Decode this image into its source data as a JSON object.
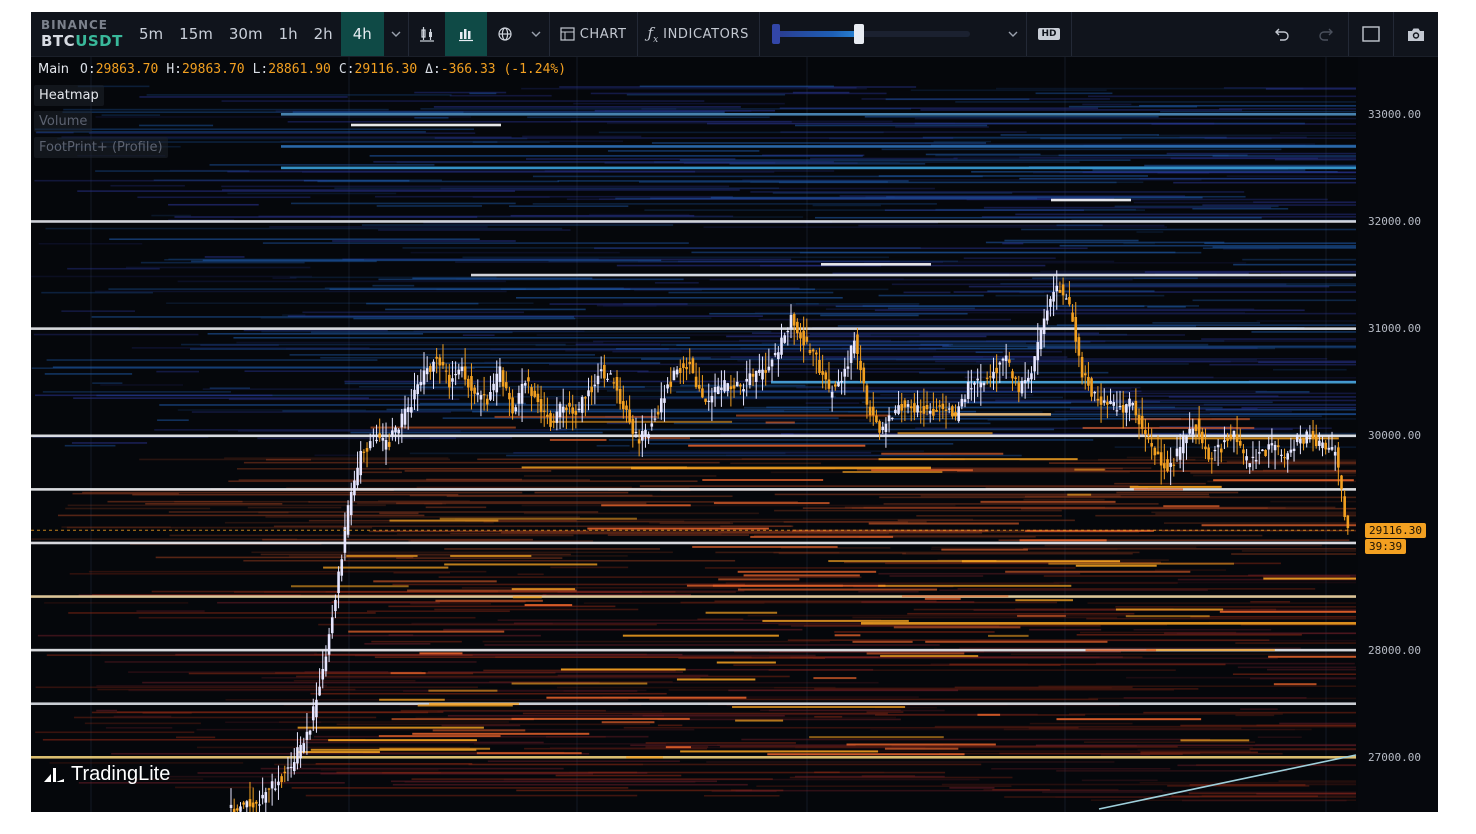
{
  "toolbar": {
    "exchange": "BINANCE",
    "pair_base": "BTC",
    "pair_quote": "USDT",
    "timeframes": [
      "5m",
      "15m",
      "30m",
      "1h",
      "2h",
      "4h"
    ],
    "active_timeframe": "4h",
    "chart_label": "CHART",
    "indicators_label": "INDICATORS",
    "hd_label": "HD",
    "icons": [
      "chevron-down-icon",
      "candles-icon",
      "bars-chart-icon",
      "globe-icon",
      "chevron-down-icon",
      "chart-icon",
      "function-icon",
      "chevron-down-icon",
      "undo-icon",
      "redo-icon",
      "fullscreen-icon",
      "camera-icon"
    ],
    "accent_color": "#0f4a46"
  },
  "legend": {
    "main_label": "Main",
    "open_key": "O:",
    "open": "29863.70",
    "high_key": "H:",
    "high": "29863.70",
    "low_key": "L:",
    "low": "28861.90",
    "close_key": "C:",
    "close": "29116.30",
    "delta_key": "Δ:",
    "delta": "-366.33 (-1.24%)"
  },
  "layers": {
    "heatmap": "Heatmap",
    "volume": "Volume",
    "footprint": "FootPrint+ (Profile)"
  },
  "price_axis": {
    "ticks": [
      "33000.00",
      "32000.00",
      "31000.00",
      "30000.00",
      "28000.00",
      "27000.00"
    ],
    "last_price": "29116.30",
    "countdown": "39:39",
    "last_color": "#f2a021"
  },
  "logo": {
    "text": "TradingLite"
  },
  "chart_data": {
    "type": "heatmap",
    "price_range": [
      26600,
      33300
    ],
    "overlay_series": "candlestick",
    "close_path": [
      [
        0,
        26520
      ],
      [
        10,
        26600
      ],
      [
        20,
        26900
      ],
      [
        26,
        27300
      ],
      [
        30,
        27800
      ],
      [
        34,
        28500
      ],
      [
        38,
        29300
      ],
      [
        42,
        29800
      ],
      [
        46,
        30000
      ],
      [
        50,
        29900
      ],
      [
        54,
        30100
      ],
      [
        58,
        30300
      ],
      [
        62,
        30600
      ],
      [
        66,
        30700
      ],
      [
        70,
        30500
      ],
      [
        74,
        30600
      ],
      [
        78,
        30400
      ],
      [
        82,
        30300
      ],
      [
        86,
        30600
      ],
      [
        90,
        30200
      ],
      [
        94,
        30500
      ],
      [
        98,
        30300
      ],
      [
        102,
        30100
      ],
      [
        106,
        30300
      ],
      [
        110,
        30200
      ],
      [
        114,
        30400
      ],
      [
        118,
        30600
      ],
      [
        122,
        30500
      ],
      [
        126,
        30200
      ],
      [
        130,
        29950
      ],
      [
        134,
        30100
      ],
      [
        138,
        30400
      ],
      [
        142,
        30600
      ],
      [
        146,
        30700
      ],
      [
        150,
        30300
      ],
      [
        154,
        30400
      ],
      [
        158,
        30500
      ],
      [
        162,
        30450
      ],
      [
        166,
        30550
      ],
      [
        170,
        30600
      ],
      [
        174,
        30800
      ],
      [
        178,
        31100
      ],
      [
        182,
        30900
      ],
      [
        186,
        30700
      ],
      [
        190,
        30400
      ],
      [
        194,
        30500
      ],
      [
        198,
        30900
      ],
      [
        202,
        30300
      ],
      [
        206,
        30000
      ],
      [
        210,
        30200
      ],
      [
        214,
        30300
      ],
      [
        218,
        30250
      ],
      [
        222,
        30200
      ],
      [
        226,
        30300
      ],
      [
        230,
        30150
      ],
      [
        234,
        30450
      ],
      [
        238,
        30500
      ],
      [
        242,
        30600
      ],
      [
        246,
        30700
      ],
      [
        250,
        30400
      ],
      [
        254,
        30600
      ],
      [
        258,
        31100
      ],
      [
        262,
        31400
      ],
      [
        266,
        31200
      ],
      [
        270,
        30600
      ],
      [
        274,
        30350
      ],
      [
        278,
        30300
      ],
      [
        282,
        30250
      ],
      [
        286,
        30300
      ],
      [
        290,
        30000
      ],
      [
        294,
        29800
      ],
      [
        298,
        29700
      ],
      [
        302,
        29950
      ],
      [
        306,
        30100
      ],
      [
        310,
        29800
      ],
      [
        314,
        29900
      ],
      [
        318,
        30050
      ],
      [
        322,
        29750
      ],
      [
        326,
        29800
      ],
      [
        330,
        29900
      ],
      [
        334,
        29800
      ],
      [
        338,
        29950
      ],
      [
        342,
        30000
      ],
      [
        346,
        29900
      ],
      [
        350,
        29850
      ],
      [
        354,
        29116
      ]
    ]
  }
}
